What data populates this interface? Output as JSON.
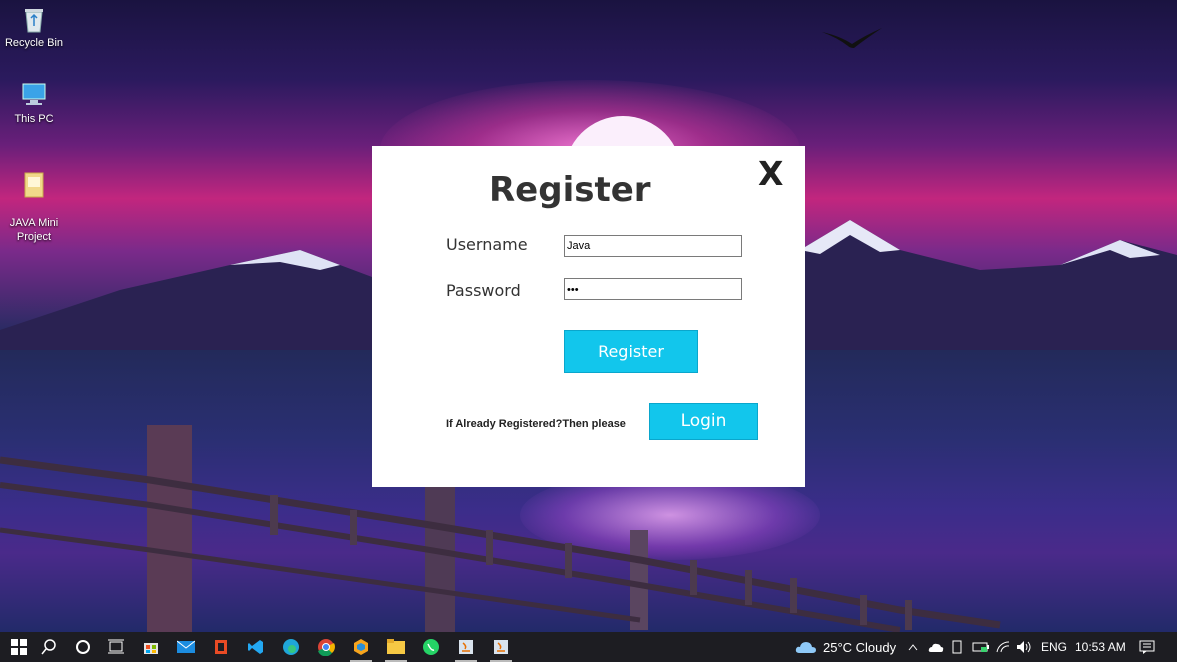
{
  "desktop": {
    "icons": [
      {
        "label": "Recycle Bin"
      },
      {
        "label": "This PC"
      },
      {
        "label": "JAVA Mini\nProject"
      }
    ]
  },
  "dialog": {
    "title": "Register",
    "close_label": "X",
    "username_label": "Username",
    "username_value": "Java",
    "password_label": "Password",
    "password_value": "•••",
    "register_button": "Register",
    "login_prompt": "If Already Registered?Then please",
    "login_button": "Login"
  },
  "taskbar": {
    "weather": "25°C  Cloudy",
    "language": "ENG",
    "clock": "10:53 AM",
    "colors": {
      "accent": "#12c6ec",
      "taskbar": "#1d1d22"
    }
  }
}
